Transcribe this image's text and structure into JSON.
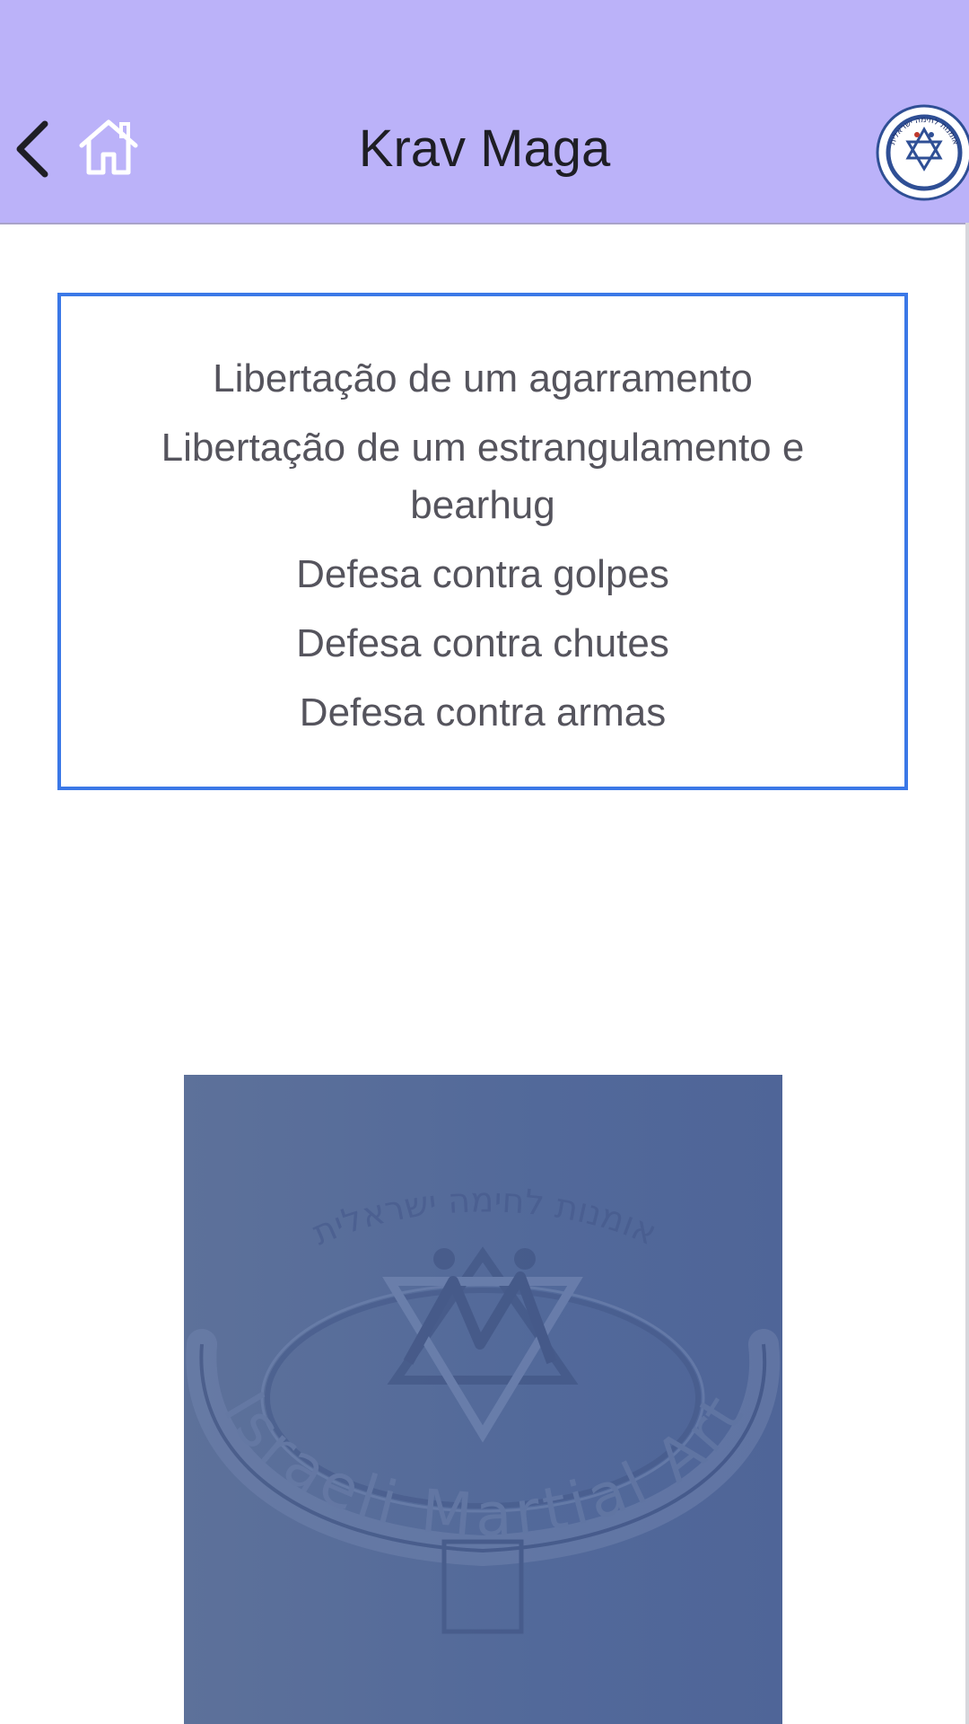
{
  "app_bar": {
    "title": "Krav Maga",
    "back_icon": "chevron-left-icon",
    "home_icon": "home-icon",
    "background_color": "#bbb2f9"
  },
  "logo": {
    "hebrew_text": "אומנות לחימה ישראלית",
    "english_text": "Israeli Martial Art"
  },
  "menu": {
    "border_color": "#3b78e7",
    "items": [
      {
        "label": "Libertação de um agarramento"
      },
      {
        "label": "Libertação de um estrangulamento e bearhug"
      },
      {
        "label": "Defesa contra golpes"
      },
      {
        "label": "Defesa contra chutes"
      },
      {
        "label": "Defesa contra armas"
      }
    ]
  },
  "banner": {
    "hebrew_text": "אומנות לחימה ישראלית",
    "english_text": "Israeli Martial Art",
    "background_color": "#55699a"
  }
}
